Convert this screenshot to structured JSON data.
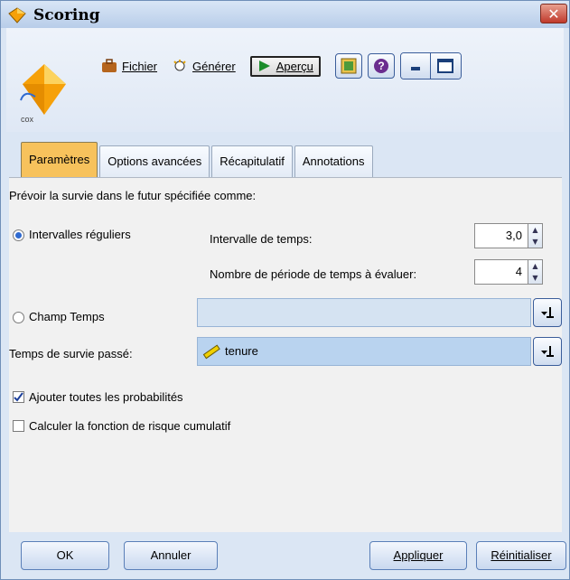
{
  "window": {
    "title": "Scoring",
    "close": "✕"
  },
  "node_icon": {
    "label": "cox"
  },
  "toolbar": {
    "fichier": "Fichier",
    "generer": "Générer",
    "apercu": "Aperçu"
  },
  "tabs": [
    "Paramètres",
    "Options avancées",
    "Récapitulatif",
    "Annotations"
  ],
  "panel": {
    "heading": "Prévoir la survie dans le futur spécifiée comme:",
    "regular_intervals": "Intervalles réguliers",
    "time_interval_label": "Intervalle de temps:",
    "time_interval_value": "3,0",
    "periods_label": "Nombre de période de temps à évaluer:",
    "periods_value": "4",
    "time_field": "Champ Temps",
    "past_survival_label": "Temps de survie passé:",
    "past_survival_value": "tenure",
    "add_all_probs": "Ajouter toutes les probabilités",
    "cumulative_hazard": "Calculer la fonction de risque cumulatif"
  },
  "footer": {
    "ok": "OK",
    "annuler": "Annuler",
    "appliquer": "Appliquer",
    "reinitialiser": "Réinitialiser"
  }
}
